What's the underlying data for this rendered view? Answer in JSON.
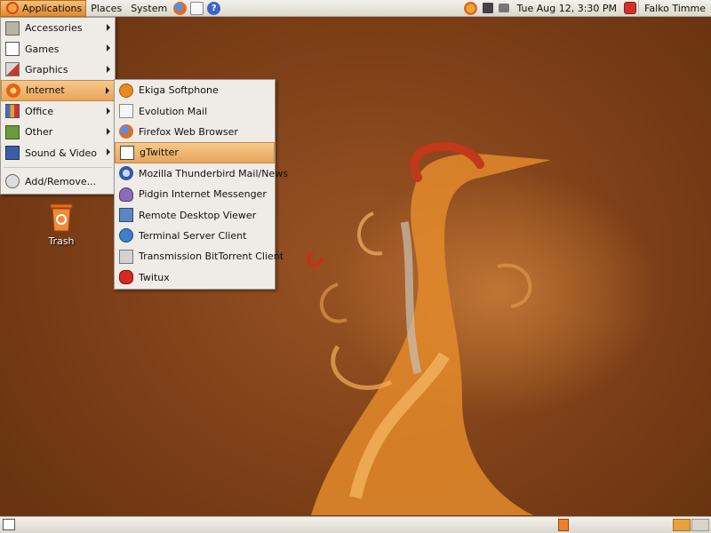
{
  "top_panel": {
    "menus": [
      "Applications",
      "Places",
      "System"
    ],
    "launchers": [
      "firefox-icon",
      "evolution-mail-icon",
      "help-icon"
    ],
    "clock": "Tue Aug 12,  3:30 PM",
    "user": "Falko Timme"
  },
  "applications_menu": {
    "items": [
      {
        "label": "Accessories",
        "icon": "accessories-icon",
        "submenu": true
      },
      {
        "label": "Games",
        "icon": "games-icon",
        "submenu": true
      },
      {
        "label": "Graphics",
        "icon": "graphics-icon",
        "submenu": true
      },
      {
        "label": "Internet",
        "icon": "internet-icon",
        "submenu": true,
        "selected": true
      },
      {
        "label": "Office",
        "icon": "office-icon",
        "submenu": true
      },
      {
        "label": "Other",
        "icon": "other-icon",
        "submenu": true
      },
      {
        "label": "Sound & Video",
        "icon": "sound-video-icon",
        "submenu": true
      }
    ],
    "footer_item": {
      "label": "Add/Remove...",
      "icon": "add-remove-icon"
    }
  },
  "internet_submenu": {
    "items": [
      {
        "label": "Ekiga Softphone",
        "icon": "ekiga-icon"
      },
      {
        "label": "Evolution Mail",
        "icon": "evolution-icon"
      },
      {
        "label": "Firefox Web Browser",
        "icon": "firefox-icon"
      },
      {
        "label": "gTwitter",
        "icon": "gtwitter-icon",
        "highlighted": true
      },
      {
        "label": "Mozilla Thunderbird Mail/News",
        "icon": "thunderbird-icon"
      },
      {
        "label": "Pidgin Internet Messenger",
        "icon": "pidgin-icon"
      },
      {
        "label": "Remote Desktop Viewer",
        "icon": "remote-desktop-icon"
      },
      {
        "label": "Terminal Server Client",
        "icon": "terminal-server-icon"
      },
      {
        "label": "Transmission BitTorrent Client",
        "icon": "transmission-icon"
      },
      {
        "label": "Twitux",
        "icon": "twitux-icon"
      }
    ]
  },
  "desktop": {
    "trash_label": "Trash"
  },
  "colors": {
    "highlight": "#e9a55a",
    "panel": "#dcd8cf",
    "menu_bg": "#efebe7",
    "desktop": "#8a4a1e"
  }
}
